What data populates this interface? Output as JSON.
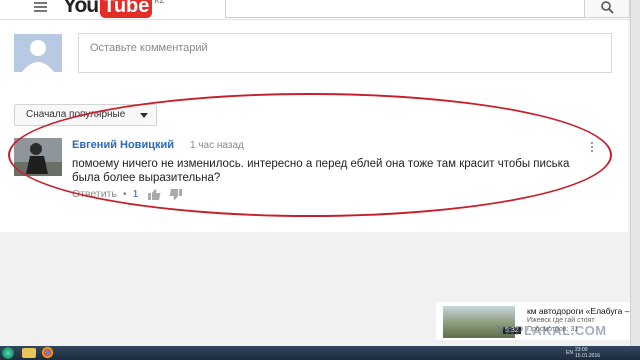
{
  "header": {
    "logo_you": "You",
    "logo_tube": "Tube",
    "logo_region": "KZ"
  },
  "comment_form": {
    "placeholder": "Оставьте комментарий"
  },
  "sort": {
    "label": "Сначала популярные"
  },
  "comment": {
    "author": "Евгений Новицкий",
    "time": "1 час назад",
    "text": "помоему ничего не изменилось. интересно а перед еблей она тоже там красит чтобы писька была более выразительна?",
    "reply_label": "Ответить",
    "separator": "•",
    "like_count": "1"
  },
  "recommendation": {
    "title": "км автодороги «Елабуга –",
    "channel": "Ижевск где гай стоят",
    "views": "Просмотров: 31",
    "duration": "5:32"
  },
  "watermark": "YAPLAKAL.COM",
  "taskbar": {
    "lang": "EN",
    "clock_time": "23:00",
    "clock_date": "15.01.2016"
  },
  "colors": {
    "accent": "#2a6ab8",
    "annotation": "#c6202c",
    "logo_red": "#e52d27"
  }
}
